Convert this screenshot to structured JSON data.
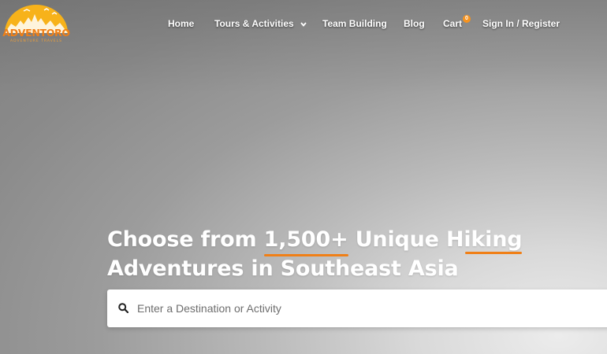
{
  "brand": {
    "name": "ADVENTORO",
    "tagline": "ADVENTURE TRAVELS"
  },
  "nav": {
    "items": [
      {
        "label": "Home"
      },
      {
        "label": "Tours & Activities",
        "icon": "chevron-down-icon"
      },
      {
        "label": "Team Building"
      },
      {
        "label": "Blog"
      },
      {
        "label": "Cart",
        "badge": "0"
      },
      {
        "label": "Sign In / Register"
      }
    ]
  },
  "hero": {
    "line1_start": "Choose from ",
    "line1_highlight": "1,500+",
    "line1_mid": " Unique H",
    "line1_end": "iking",
    "line2": "Adventures in Southeast Asia"
  },
  "search": {
    "icon": "search-icon",
    "placeholder": "Enter a Destination or Activity",
    "value": ""
  },
  "colors": {
    "accent": "#f07f16",
    "logo_yellow": "#f7b21a"
  }
}
